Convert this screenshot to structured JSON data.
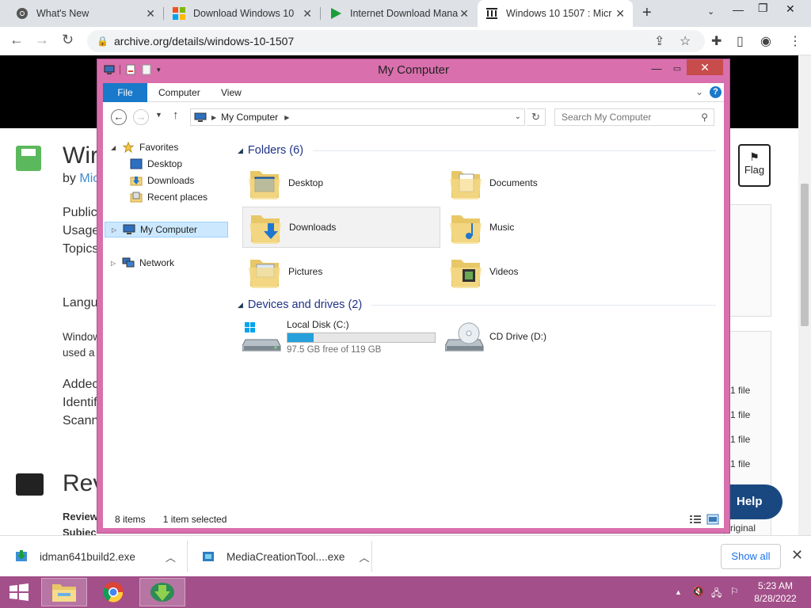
{
  "browser": {
    "tabs": [
      {
        "title": "What's New",
        "icon": "chrome-icon"
      },
      {
        "title": "Download Windows 10",
        "icon": "windows-logo-icon"
      },
      {
        "title": "Internet Download Mana",
        "icon": "play-green-icon"
      },
      {
        "title": "Windows 10 1507 : Micr",
        "icon": "archive-org-icon",
        "active": true
      }
    ],
    "url": "archive.org/details/windows-10-1507"
  },
  "webpage": {
    "title_fragment": "Wir",
    "by_fragment": "by",
    "by_link_fragment": "Mic",
    "meta_fragments": [
      "Public",
      "Usage",
      "Topics"
    ],
    "language_fragment": "Langu",
    "desc_fragments": [
      "Window",
      "used a"
    ],
    "added_fragments": [
      "Addec",
      "Identif",
      "Scann"
    ],
    "reviews_fragment": "Rev",
    "reviews_sub": [
      "Review",
      "Subiec"
    ],
    "flag_label": "Flag",
    "file_counts": [
      "1 file",
      "1 file",
      "1 file",
      "1 file"
    ],
    "original_fragment": "riginal",
    "help_label": "Help"
  },
  "explorer": {
    "title": "My Computer",
    "ribbon_tabs": [
      "File",
      "Computer",
      "View"
    ],
    "address": {
      "crumb": "My Computer"
    },
    "search_placeholder": "Search My Computer",
    "nav": {
      "favorites": "Favorites",
      "favorites_items": [
        "Desktop",
        "Downloads",
        "Recent places"
      ],
      "my_computer": "My Computer",
      "network": "Network"
    },
    "folders_header": "Folders (6)",
    "folders": [
      "Desktop",
      "Documents",
      "Downloads",
      "Music",
      "Pictures",
      "Videos"
    ],
    "devices_header": "Devices and drives (2)",
    "drives": [
      {
        "name": "Local Disk (C:)",
        "free": "97.5 GB free of 119 GB",
        "used_fraction": 0.18
      },
      {
        "name": "CD Drive (D:)"
      }
    ],
    "status": {
      "items": "8 items",
      "selected": "1 item selected"
    },
    "accent": "#1979ca",
    "frame_color": "#d96fad"
  },
  "downloads": {
    "items": [
      "idman641build2.exe",
      "MediaCreationTool....exe"
    ],
    "show_all": "Show all"
  },
  "taskbar": {
    "time": "5:23 AM",
    "date": "8/28/2022",
    "color": "#a34f8a"
  }
}
